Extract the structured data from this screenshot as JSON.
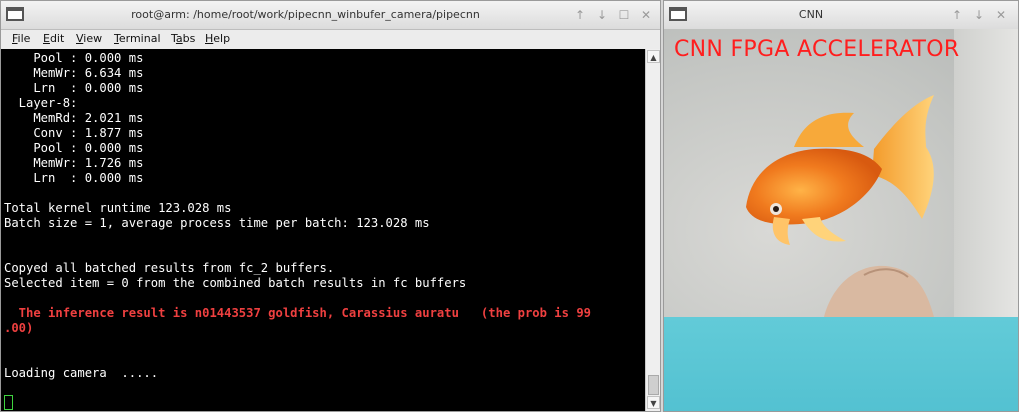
{
  "terminal_window": {
    "title": "root@arm: /home/root/work/pipecnn_winbufer_camera/pipecnn",
    "menu": [
      {
        "pre": "",
        "key": "F",
        "post": "ile"
      },
      {
        "pre": "",
        "key": "E",
        "post": "dit"
      },
      {
        "pre": "",
        "key": "V",
        "post": "iew"
      },
      {
        "pre": "",
        "key": "T",
        "post": "erminal"
      },
      {
        "pre": "T",
        "key": "a",
        "post": "bs"
      },
      {
        "pre": "",
        "key": "H",
        "post": "elp"
      }
    ],
    "lines": [
      "    Pool : 0.000 ms",
      "    MemWr: 6.634 ms",
      "    Lrn  : 0.000 ms",
      "  Layer-8:",
      "    MemRd: 2.021 ms",
      "    Conv : 1.877 ms",
      "    Pool : 0.000 ms",
      "    MemWr: 1.726 ms",
      "    Lrn  : 0.000 ms",
      "",
      "Total kernel runtime 123.028 ms",
      "Batch size = 1, average process time per batch: 123.028 ms",
      "",
      "",
      "Copyed all batched results from fc_2 buffers.",
      "Selected item = 0 from the combined batch results in fc buffers",
      "",
      "  The inference result is n01443537 goldfish, Carassius auratu   (the prob is 99",
      ".00)",
      "",
      "",
      "Loading camera  .....",
      ""
    ],
    "highlight_lines": [
      17,
      18
    ],
    "highlight_color": "#ef4040",
    "scrollbar": {
      "up_icon": "▲",
      "down_icon": "▼"
    }
  },
  "cnn_window": {
    "title": "CNN",
    "overlay_text": "CNN  FPGA  ACCELERATOR",
    "overlay_color": "#ff1e1e",
    "camera_subject": "goldfish"
  },
  "window_buttons": {
    "up": "↑",
    "down": "↓",
    "max": "☐",
    "close": "✕"
  }
}
